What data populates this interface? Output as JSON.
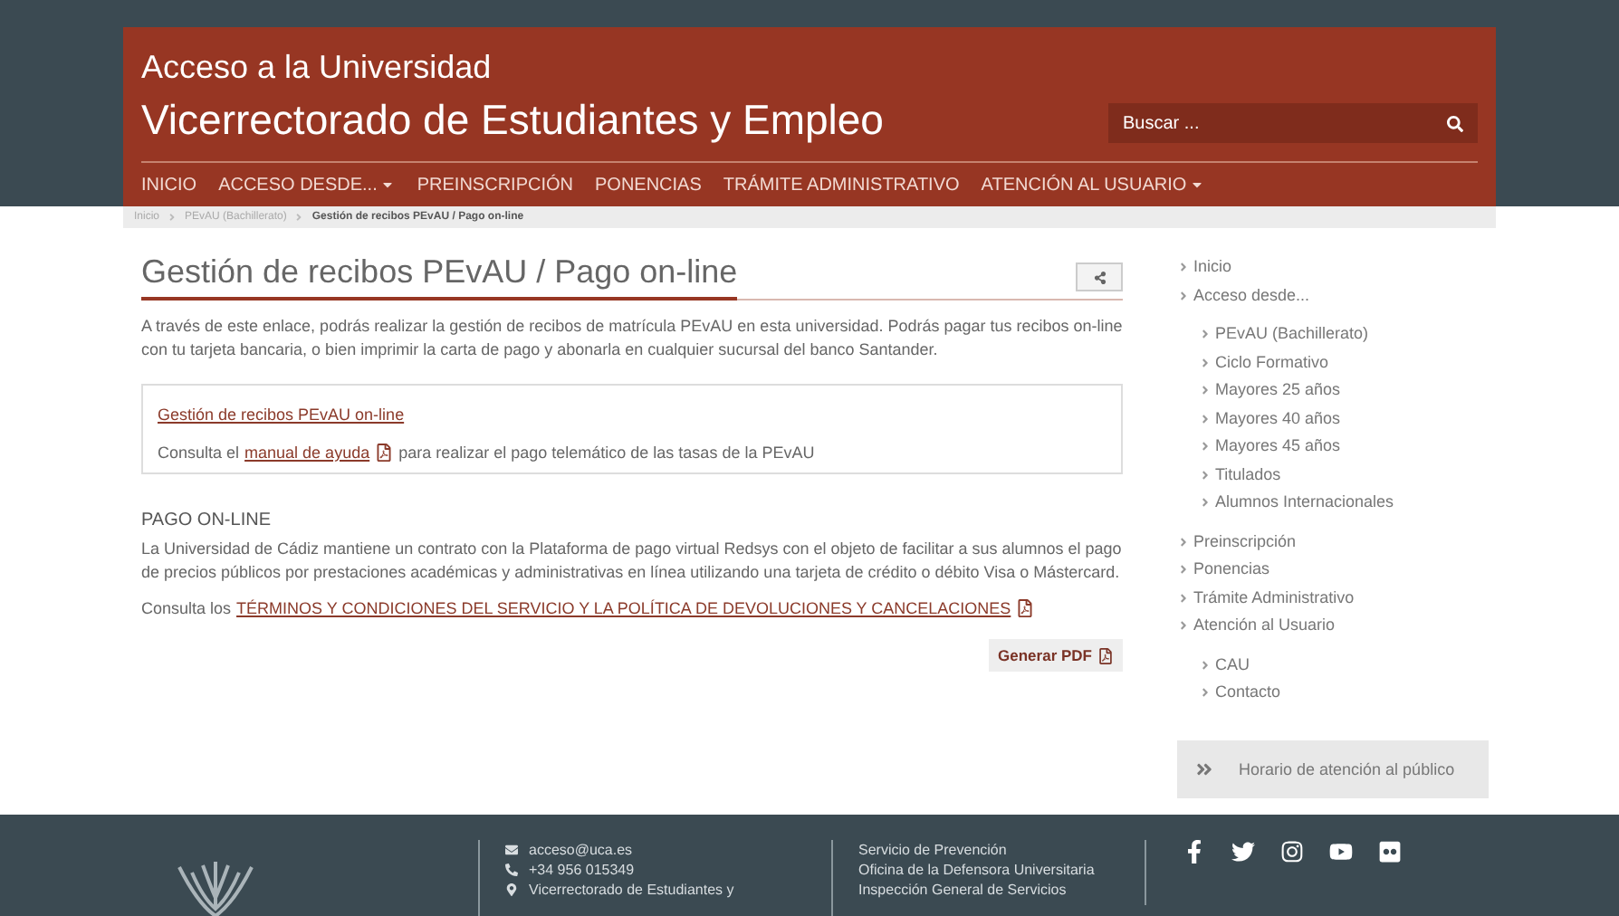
{
  "header": {
    "title": "Acceso a la Universidad",
    "subtitle": "Vicerrectorado de Estudiantes y Empleo",
    "search": {
      "placeholder": "Buscar ..."
    }
  },
  "nav": [
    {
      "label": "INICIO",
      "has_menu": false
    },
    {
      "label": "ACCESO DESDE...",
      "has_menu": true
    },
    {
      "label": "PREINSCRIPCIÓN",
      "has_menu": false
    },
    {
      "label": "PONENCIAS",
      "has_menu": false
    },
    {
      "label": "TRÁMITE ADMINISTRATIVO",
      "has_menu": false
    },
    {
      "label": "ATENCIÓN AL USUARIO",
      "has_menu": true
    }
  ],
  "breadcrumb": [
    {
      "label": "Inicio",
      "current": false
    },
    {
      "label": "PEvAU (Bachillerato)",
      "current": false
    },
    {
      "label": "Gestión de recibos PEvAU / Pago on-line",
      "current": true
    }
  ],
  "article": {
    "title": "Gestión de recibos PEvAU / Pago on-line",
    "intro": "A través de este enlace, podrás realizar la gestión de recibos de matrícula PEvAU en esta universidad. Podrás pagar tus recibos on-line con tu tarjeta bancaria, o bien imprimir la carta de pago y abonarla en cualquier sucursal del banco Santander.",
    "box": {
      "link": "Gestión de recibos PEvAU on-line",
      "text_before": "Consulta el",
      "manual_link": "manual de ayuda",
      "text_after": "para realizar el pago telemático de las tasas de la PEvAU"
    },
    "section_title": "PAGO ON-LINE",
    "section_text": "La Universidad de Cádiz mantiene un contrato con la Plataforma de pago virtual Redsys con el objeto de facilitar a sus alumnos el pago de precios públicos por prestaciones académicas y administrativas en línea utilizando una tarjeta de crédito o débito Visa o Mástercard.",
    "terms_before": "Consulta los",
    "terms_link": "TÉRMINOS Y CONDICIONES DEL SERVICIO Y LA POLÍTICA DE DEVOLUCIONES Y CANCELACIONES",
    "pdf_button": "Generar PDF"
  },
  "sidebar": {
    "items": [
      {
        "label": "Inicio"
      },
      {
        "label": "Acceso desde...",
        "children": [
          {
            "label": "PEvAU (Bachillerato)"
          },
          {
            "label": "Ciclo Formativo"
          },
          {
            "label": "Mayores 25 años"
          },
          {
            "label": "Mayores 40 años"
          },
          {
            "label": "Mayores 45 años"
          },
          {
            "label": "Titulados"
          },
          {
            "label": "Alumnos Internacionales"
          }
        ]
      },
      {
        "label": "Preinscripción"
      },
      {
        "label": "Ponencias"
      },
      {
        "label": "Trámite Administrativo"
      },
      {
        "label": "Atención al Usuario",
        "children": [
          {
            "label": "CAU"
          },
          {
            "label": "Contacto"
          }
        ]
      }
    ],
    "hours_button": "Horario de atención al público"
  },
  "footer": {
    "contact": [
      {
        "kind": "email",
        "text": "acceso@uca.es"
      },
      {
        "kind": "phone",
        "text": "+34 956 015349"
      },
      {
        "kind": "address",
        "text": "Vicerrectorado de Estudiantes y"
      }
    ],
    "links": [
      "Servicio de Prevención",
      "Oficina de la Defensora Universitaria",
      "Inspección General de Servicios"
    ],
    "social": [
      {
        "kind": "facebook"
      },
      {
        "kind": "twitter"
      },
      {
        "kind": "instagram"
      },
      {
        "kind": "youtube"
      },
      {
        "kind": "flickr"
      }
    ]
  }
}
